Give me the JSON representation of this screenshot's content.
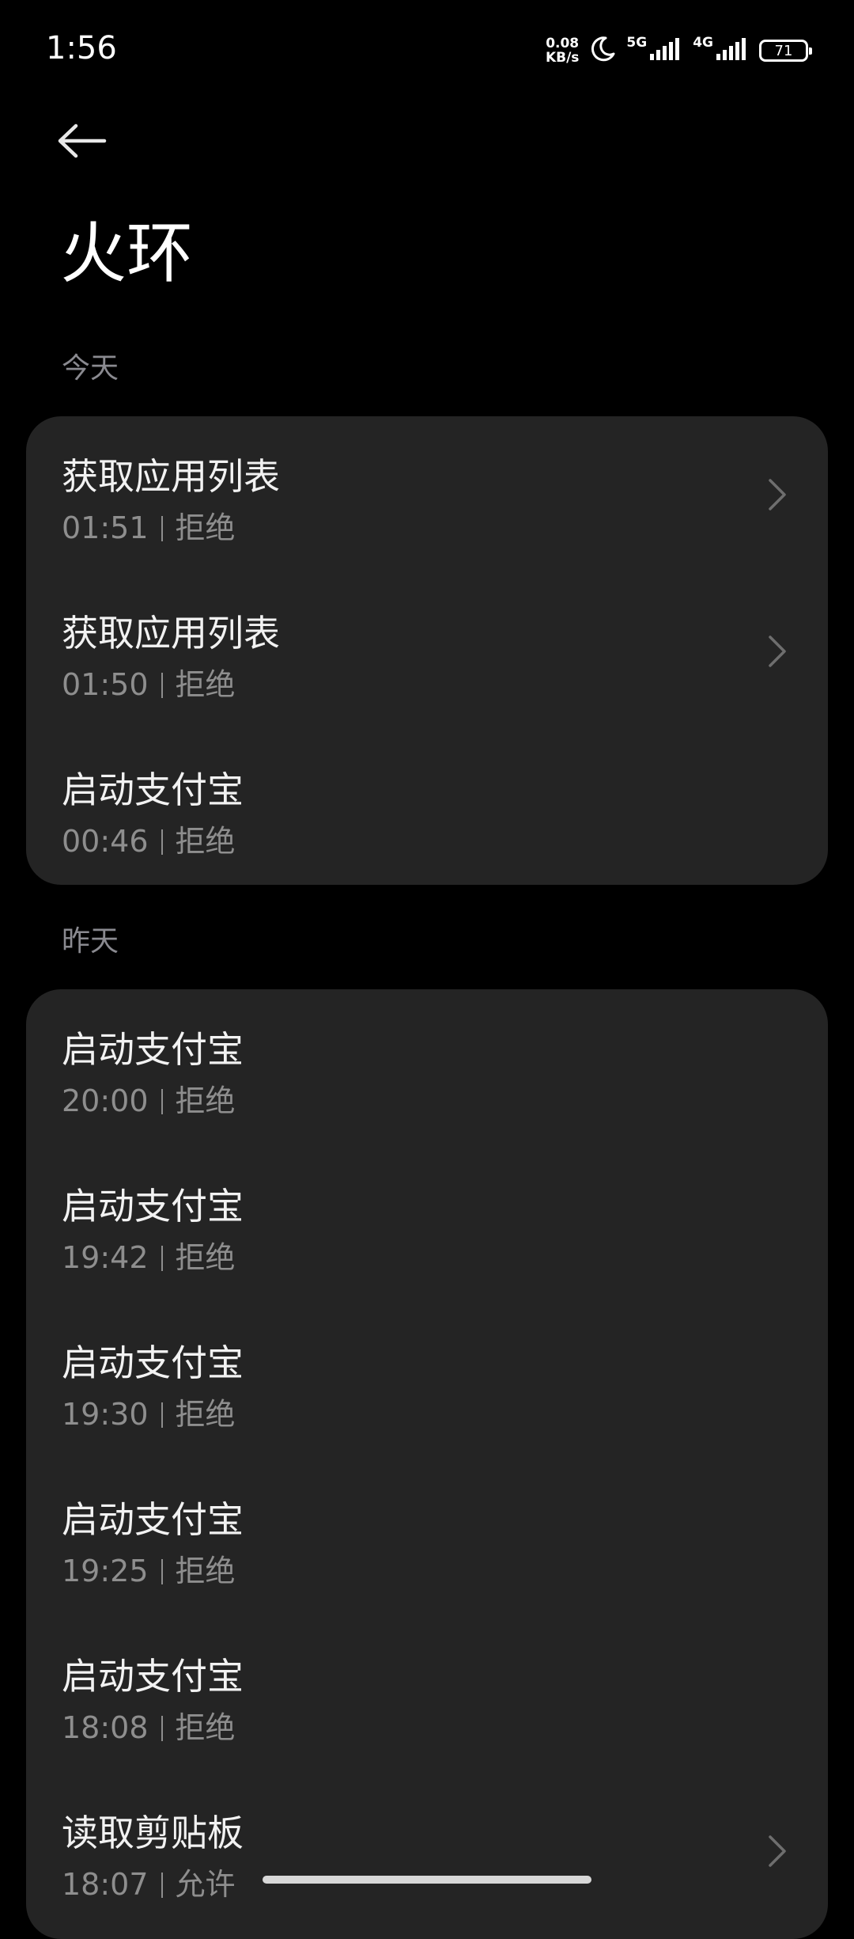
{
  "status_bar": {
    "time": "1:56",
    "net_speed_value": "0.08",
    "net_speed_unit": "KB/s",
    "signal1_label": "5G",
    "signal2_label": "4G",
    "battery": "71",
    "icons": [
      "moon-icon",
      "signal-icon",
      "battery-icon"
    ]
  },
  "header": {
    "back_icon": "arrow-left-icon",
    "title": "火环"
  },
  "sections": [
    {
      "label": "今天",
      "items": [
        {
          "title": "获取应用列表",
          "time": "01:51",
          "status": "拒绝",
          "has_chevron": true
        },
        {
          "title": "获取应用列表",
          "time": "01:50",
          "status": "拒绝",
          "has_chevron": true
        },
        {
          "title": "启动支付宝",
          "time": "00:46",
          "status": "拒绝",
          "has_chevron": false
        }
      ]
    },
    {
      "label": "昨天",
      "items": [
        {
          "title": "启动支付宝",
          "time": "20:00",
          "status": "拒绝",
          "has_chevron": false
        },
        {
          "title": "启动支付宝",
          "time": "19:42",
          "status": "拒绝",
          "has_chevron": false
        },
        {
          "title": "启动支付宝",
          "time": "19:30",
          "status": "拒绝",
          "has_chevron": false
        },
        {
          "title": "启动支付宝",
          "time": "19:25",
          "status": "拒绝",
          "has_chevron": false
        },
        {
          "title": "启动支付宝",
          "time": "18:08",
          "status": "拒绝",
          "has_chevron": false
        },
        {
          "title": "读取剪贴板",
          "time": "18:07",
          "status": "允许",
          "has_chevron": true
        }
      ]
    }
  ],
  "colors": {
    "background": "#000000",
    "card": "#242424",
    "section_label": "#8a8a90",
    "secondary_text": "#8e8e8e"
  }
}
